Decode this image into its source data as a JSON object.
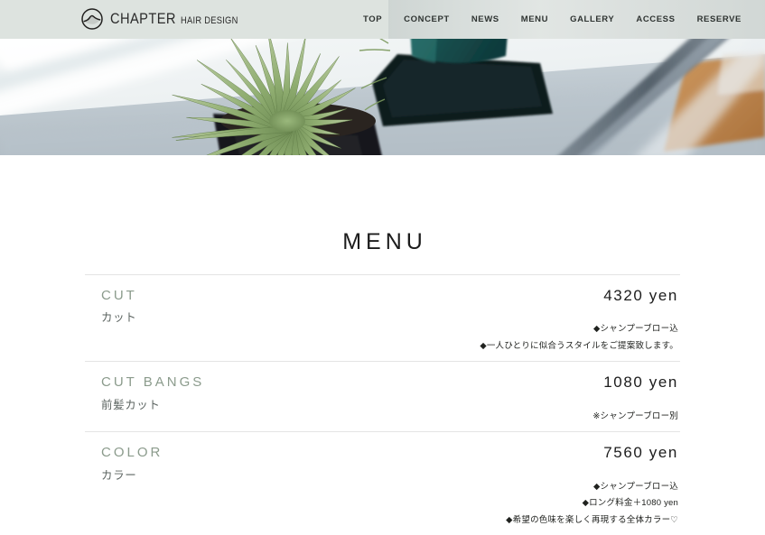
{
  "header": {
    "logo": {
      "icon": "circle-wave-logo-icon",
      "brand": "CHAPTER",
      "tagline": "HAIR DESIGN"
    },
    "nav": [
      {
        "label": "TOP",
        "name": "nav-item-top"
      },
      {
        "label": "CONCEPT",
        "name": "nav-item-concept"
      },
      {
        "label": "NEWS",
        "name": "nav-item-news"
      },
      {
        "label": "MENU",
        "name": "nav-item-menu"
      },
      {
        "label": "GALLERY",
        "name": "nav-item-gallery"
      },
      {
        "label": "ACCESS",
        "name": "nav-item-access"
      },
      {
        "label": "RESERVE",
        "name": "nav-item-reserve"
      }
    ],
    "background_color": "#dde3df"
  },
  "hero": {
    "alt": "potted spiky green plant on gray table",
    "colors": {
      "plant_green": "#8fa878",
      "pot_teal": "#1e5a58",
      "tray_black": "#0d1a1c",
      "surface_gray": "#c3ccd2",
      "wood_brown": "#c08a50",
      "wall_white": "#f4f6f7"
    }
  },
  "menu": {
    "title": "MENU",
    "accent_color": "#8b9b8c",
    "items": [
      {
        "name_en": "CUT",
        "name_ja": "カット",
        "price": "4320 yen",
        "notes": [
          "◆シャンプーブロー込",
          "◆一人ひとりに似合うスタイルをご提案致します。"
        ]
      },
      {
        "name_en": "CUT BANGS",
        "name_ja": "前髪カット",
        "price": "1080 yen",
        "notes": [
          "※シャンプーブロー別"
        ]
      },
      {
        "name_en": "COLOR",
        "name_ja": "カラー",
        "price": "7560 yen",
        "notes": [
          "◆シャンプーブロー込",
          "◆ロング料金＋1080 yen",
          "◆希望の色味を楽しく再現する全体カラー♡"
        ]
      }
    ]
  }
}
